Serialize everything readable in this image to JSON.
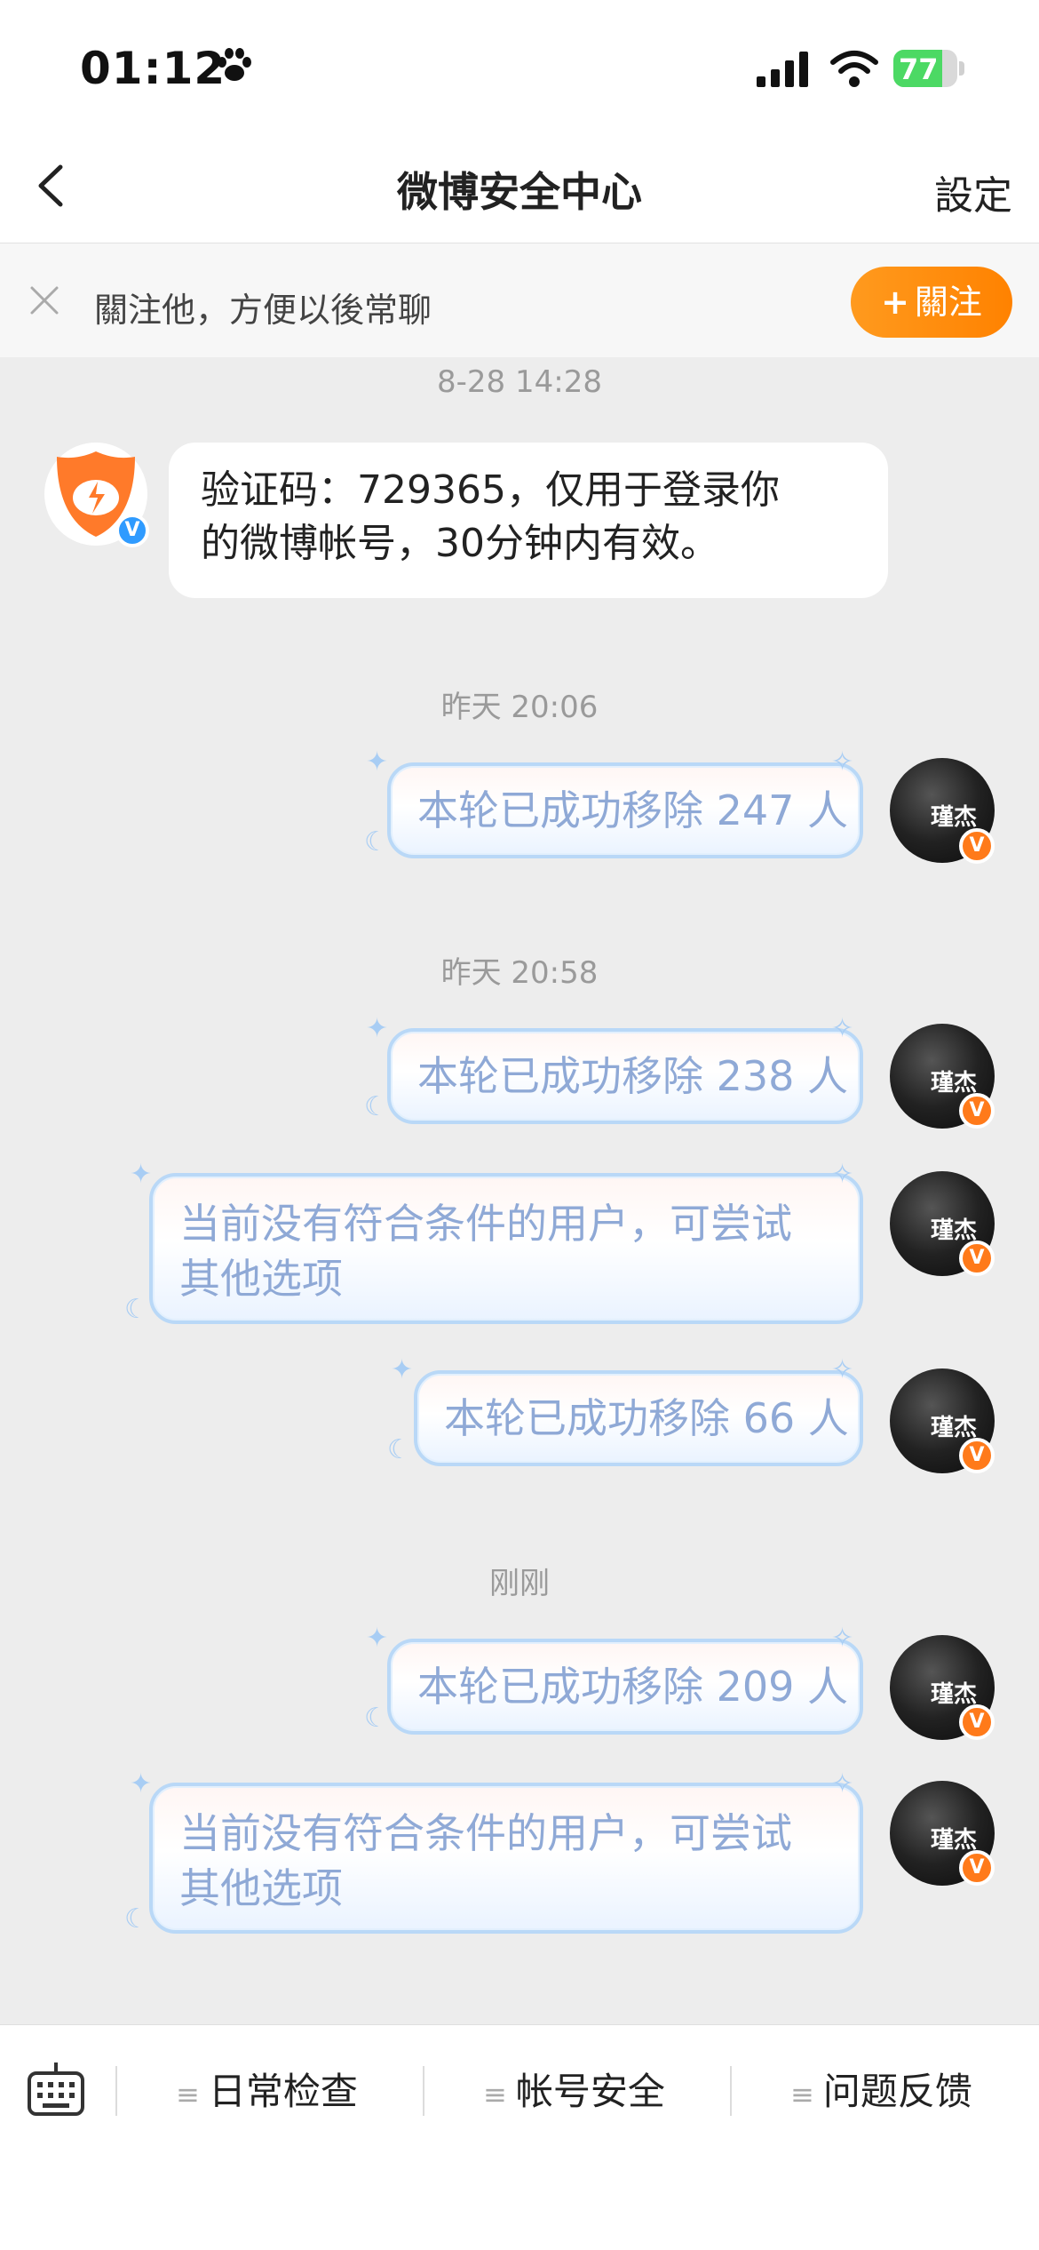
{
  "status_bar": {
    "time": "01:12",
    "battery": "77",
    "battery_level_percent": 77
  },
  "nav": {
    "title": "微博安全中心",
    "settings_label": "設定"
  },
  "follow_banner": {
    "text": "關注他，方便以後常聊",
    "button_label": "關注",
    "button_plus": "+"
  },
  "messages": {
    "ts1": "8-28 14:28",
    "incoming_line1": "验证码：729365，仅用于登录你",
    "incoming_line2": "的微博帐号，30分钟内有效。",
    "ts2": "昨天 20:06",
    "m1": "本轮已成功移除 247 人",
    "ts3": "昨天 20:58",
    "m2": "本轮已成功移除 238 人",
    "m3_line1": "当前没有符合条件的用户，可尝试",
    "m3_line2": "其他选项",
    "m4": "本轮已成功移除 66 人",
    "ts4": "刚刚",
    "m5": "本轮已成功移除 209 人",
    "m6_line1": "当前没有符合条件的用户，可尝试",
    "m6_line2": "其他选项"
  },
  "badges": {
    "verify": "V",
    "vip": "V"
  },
  "toolbar": {
    "menu_glyph": "≡",
    "item1": "日常检查",
    "item2": "帐号安全",
    "item3": "问题反馈"
  },
  "colors": {
    "accent": "#ff8200",
    "bubble_text": "#8fa9d6",
    "verify_blue": "#2f9bff"
  }
}
